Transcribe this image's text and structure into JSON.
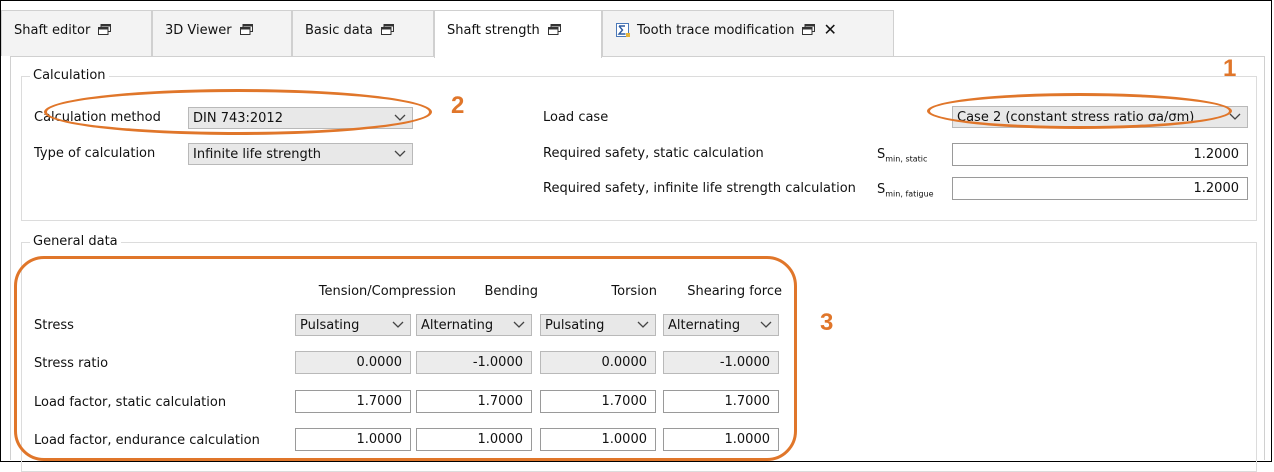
{
  "tabs": [
    {
      "label": "Shaft editor"
    },
    {
      "label": "3D Viewer"
    },
    {
      "label": "Basic data"
    },
    {
      "label": "Shaft strength"
    },
    {
      "label": "Tooth trace modification"
    }
  ],
  "calculation": {
    "group_title": "Calculation",
    "method_label": "Calculation method",
    "method_value": "DIN 743:2012",
    "type_label": "Type of calculation",
    "type_value": "Infinite life strength",
    "load_case_label": "Load case",
    "load_case_value": "Case 2 (constant stress ratio σa/σm)",
    "static_safety_label": "Required safety, static calculation",
    "static_safety_symbol": "S",
    "static_safety_sub": "min, static",
    "static_safety_value": "1.2000",
    "fatigue_safety_label": "Required safety, infinite life strength calculation",
    "fatigue_safety_symbol": "S",
    "fatigue_safety_sub": "min, fatigue",
    "fatigue_safety_value": "1.2000"
  },
  "general": {
    "group_title": "General data",
    "columns": [
      "Tension/Compression",
      "Bending",
      "Torsion",
      "Shearing force"
    ],
    "stress_label": "Stress",
    "stress_values": [
      "Pulsating",
      "Alternating",
      "Pulsating",
      "Alternating"
    ],
    "ratio_label": "Stress ratio",
    "ratio_values": [
      "0.0000",
      "-1.0000",
      "0.0000",
      "-1.0000"
    ],
    "static_label": "Load factor, static calculation",
    "static_values": [
      "1.7000",
      "1.7000",
      "1.7000",
      "1.7000"
    ],
    "endurance_label": "Load factor, endurance calculation",
    "endurance_values": [
      "1.0000",
      "1.0000",
      "1.0000",
      "1.0000"
    ]
  },
  "annotations": [
    "1",
    "2",
    "3"
  ],
  "colors": {
    "annotation": "#e0762a"
  }
}
